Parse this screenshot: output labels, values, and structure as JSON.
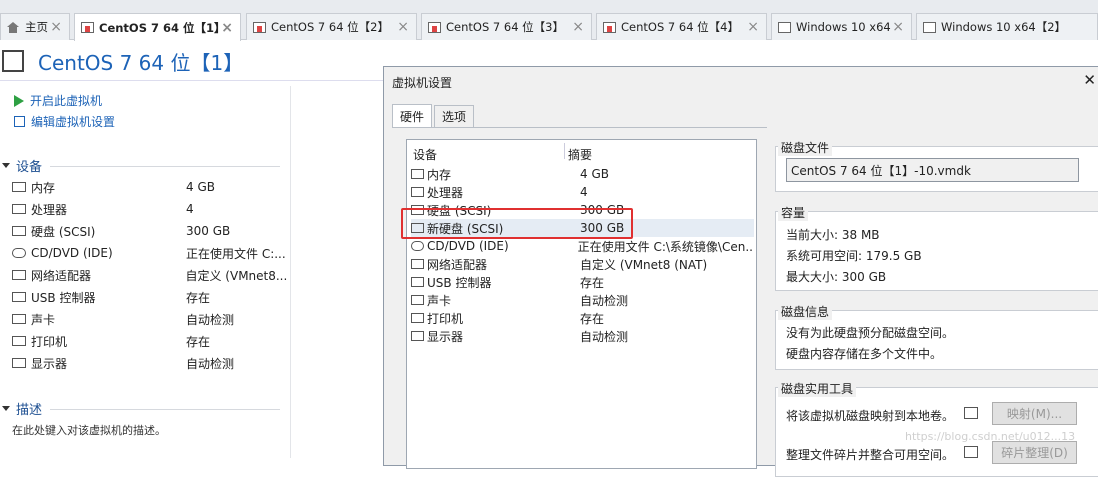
{
  "tabs": [
    {
      "label": "主页",
      "icon": "home-icon"
    },
    {
      "label": "CentOS 7 64 位【1】",
      "icon": "vm-icon"
    },
    {
      "label": "CentOS 7 64 位【2】",
      "icon": "vm-icon"
    },
    {
      "label": "CentOS 7 64 位【3】",
      "icon": "vm-icon"
    },
    {
      "label": "CentOS 7 64 位【4】",
      "icon": "vm-icon"
    },
    {
      "label": "Windows 10 x64",
      "icon": "windows-icon"
    },
    {
      "label": "Windows 10 x64【2】",
      "icon": "windows-icon"
    }
  ],
  "vm": {
    "title": "CentOS 7 64 位【1】"
  },
  "actions": {
    "power_on": "开启此虚拟机",
    "edit_settings": "编辑虚拟机设置"
  },
  "devices_section": {
    "title": "设备",
    "items": [
      {
        "name": "内存",
        "value": "4 GB",
        "icon": "memory-icon"
      },
      {
        "name": "处理器",
        "value": "4",
        "icon": "cpu-icon"
      },
      {
        "name": "硬盘 (SCSI)",
        "value": "300 GB",
        "icon": "harddisk-icon"
      },
      {
        "name": "CD/DVD (IDE)",
        "value": "正在使用文件 C:...",
        "icon": "cd-icon"
      },
      {
        "name": "网络适配器",
        "value": "自定义 (VMnet8...",
        "icon": "network-icon"
      },
      {
        "name": "USB 控制器",
        "value": "存在",
        "icon": "usb-icon"
      },
      {
        "name": "声卡",
        "value": "自动检测",
        "icon": "sound-icon"
      },
      {
        "name": "打印机",
        "value": "存在",
        "icon": "printer-icon"
      },
      {
        "name": "显示器",
        "value": "自动检测",
        "icon": "display-icon"
      }
    ]
  },
  "description_section": {
    "title": "描述",
    "placeholder": "在此处键入对该虚拟机的描述。"
  },
  "dialog": {
    "title": "虚拟机设置",
    "close": "✕",
    "tabs": [
      {
        "label": "硬件"
      },
      {
        "label": "选项"
      }
    ],
    "list": {
      "col_device": "设备",
      "col_summary": "摘要",
      "rows": [
        {
          "name": "内存",
          "summary": "4 GB"
        },
        {
          "name": "处理器",
          "summary": "4"
        },
        {
          "name": "硬盘 (SCSI)",
          "summary": "300 GB"
        },
        {
          "name": "新硬盘 (SCSI)",
          "summary": "300 GB"
        },
        {
          "name": "CD/DVD (IDE)",
          "summary": "正在使用文件 C:\\系统镜像\\Cen..."
        },
        {
          "name": "网络适配器",
          "summary": "自定义 (VMnet8 (NAT)"
        },
        {
          "name": "USB 控制器",
          "summary": "存在"
        },
        {
          "name": "声卡",
          "summary": "自动检测"
        },
        {
          "name": "打印机",
          "summary": "存在"
        },
        {
          "name": "显示器",
          "summary": "自动检测"
        }
      ]
    },
    "disk_file": {
      "title": "磁盘文件",
      "value": "CentOS 7 64 位【1】-10.vmdk"
    },
    "capacity": {
      "title": "容量",
      "current": "当前大小: 38 MB",
      "available": "系统可用空间: 179.5 GB",
      "max": "最大大小: 300 GB"
    },
    "disk_info": {
      "title": "磁盘信息",
      "line1": "没有为此硬盘预分配磁盘空间。",
      "line2": "硬盘内容存储在多个文件中。"
    },
    "disk_tools": {
      "title": "磁盘实用工具",
      "map_text": "将该虚拟机磁盘映射到本地卷。",
      "map_button": "映射(M)...",
      "defrag_text": "整理文件碎片并整合可用空间。",
      "defrag_button": "碎片整理(D)"
    },
    "watermark": "https://blog.csdn.net/u012...13"
  }
}
